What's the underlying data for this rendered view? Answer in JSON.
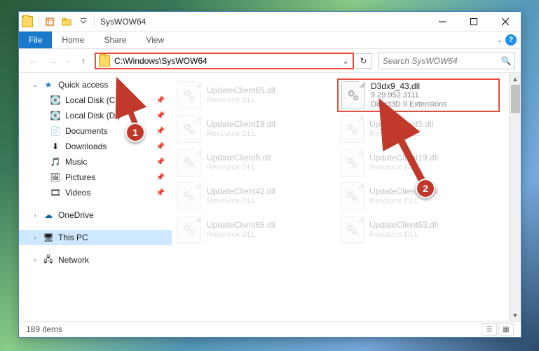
{
  "window": {
    "title": "SysWOW64",
    "min_tip": "Minimize",
    "max_tip": "Maximize",
    "close_tip": "Close"
  },
  "ribbon": {
    "file": "File",
    "home": "Home",
    "share": "Share",
    "view": "View"
  },
  "nav": {
    "address": "C:\\Windows\\SysWOW64",
    "search_placeholder": "Search SysWOW64"
  },
  "sidebar": {
    "quick_access": "Quick access",
    "local_c": "Local Disk (C:)",
    "local_d": "Local Disk (D:)",
    "documents": "Documents",
    "downloads": "Downloads",
    "music": "Music",
    "pictures": "Pictures",
    "videos": "Videos",
    "onedrive": "OneDrive",
    "this_pc": "This PC",
    "network": "Network"
  },
  "files": [
    {
      "name": "UpdateClient65.dll",
      "desc": "Resource DLL"
    },
    {
      "name": "D3dx9_43.dll",
      "desc": "9.29.952.3111",
      "desc2": "Direct3D 9 Extensions",
      "highlighted": true
    },
    {
      "name": "UpdateClient19.dll",
      "desc": "Resource DLL"
    },
    {
      "name": "UpdateClient5.dll",
      "desc": "Resource DLL"
    },
    {
      "name": "UpdateClient5.dll",
      "desc": "Resource DLL"
    },
    {
      "name": "UpdateClient19.dll",
      "desc": "Resource DLL"
    },
    {
      "name": "UpdateClient42.dll",
      "desc": "Resource DLL"
    },
    {
      "name": "UpdateClient19.dll",
      "desc": "Resource DLL"
    },
    {
      "name": "UpdateClient65.dll",
      "desc": "Resource DLL"
    },
    {
      "name": "UpdateClient63.dll",
      "desc": "Resource DLL"
    }
  ],
  "status": {
    "item_count": "189 items"
  },
  "annotations": {
    "callout1": "1",
    "callout2": "2"
  }
}
